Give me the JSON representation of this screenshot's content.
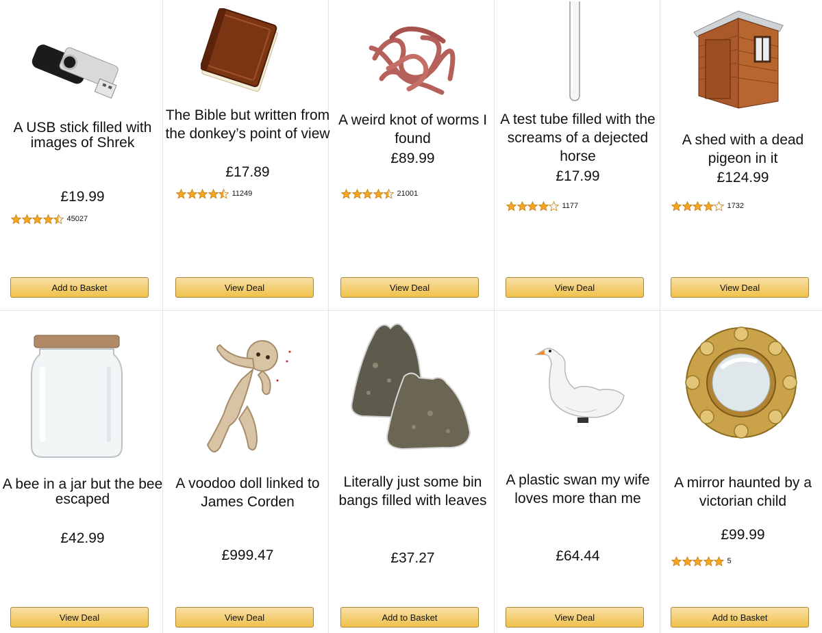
{
  "products": [
    {
      "title": "A USB stick filled with images of Shrek",
      "price": "£19.99",
      "rating": 4.5,
      "reviews": "45027",
      "button": "Add to Basket",
      "icon": "usb-stick"
    },
    {
      "title": "The Bible but written from the donkey’s point of view",
      "price": "£17.89",
      "rating": 4.5,
      "reviews": "11249",
      "button": "View Deal",
      "icon": "book"
    },
    {
      "title": "A weird knot of worms I found",
      "price": "£89.99",
      "rating": 4.5,
      "reviews": "21001",
      "button": "View Deal",
      "icon": "worms"
    },
    {
      "title": "A test tube filled with the screams of a dejected horse",
      "price": "£17.99",
      "rating": 4,
      "reviews": "1177",
      "button": "View Deal",
      "icon": "test-tube"
    },
    {
      "title": "A shed with a dead pigeon in it",
      "price": "£124.99",
      "rating": 4,
      "reviews": "1732",
      "button": "View Deal",
      "icon": "shed"
    },
    {
      "title": "A bee in a jar but the bee escaped",
      "price": "£42.99",
      "button": "View Deal",
      "icon": "jar"
    },
    {
      "title": "A voodoo doll linked to James Corden",
      "price": "£999.47",
      "button": "View Deal",
      "icon": "voodoo-doll"
    },
    {
      "title": "Literally just some bin bangs filled with leaves",
      "price": "£37.27",
      "button": "Add to Basket",
      "icon": "bin-bags"
    },
    {
      "title": "A plastic swan my wife loves more than me",
      "price": "£64.44",
      "button": "View Deal",
      "icon": "swan"
    },
    {
      "title": "A mirror haunted by a victorian child",
      "price": "£99.99",
      "rating": 5,
      "reviews": "5",
      "button": "Add to Basket",
      "icon": "mirror"
    }
  ],
  "colors": {
    "star": "#f5a623",
    "star_stroke": "#c47d0e",
    "button_top": "#f7dfa5",
    "button_bottom": "#f0c14b",
    "button_border": "#a88734",
    "divider": "#e4e4e4"
  }
}
